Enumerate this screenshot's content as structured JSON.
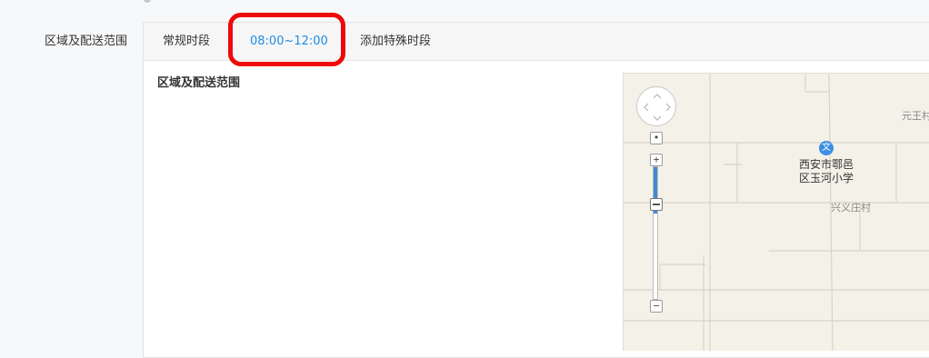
{
  "form": {
    "field_label": "区域及配送范围"
  },
  "tabs": [
    {
      "label": "常规时段",
      "active": false
    },
    {
      "label": "08:00~12:00",
      "active": true
    },
    {
      "label": "添加特殊时段",
      "active": false
    }
  ],
  "section": {
    "title": "区域及配送范围"
  },
  "map": {
    "poi": {
      "icon_text": "文",
      "line1": "西安市鄠邑",
      "line2": "区玉河小学"
    },
    "labels": {
      "village_top_right": "元王村",
      "village_mid": "兴义庄村"
    },
    "zoom": {
      "level_fraction": 0.35
    }
  },
  "colors": {
    "active_tab": "#1a8ce5",
    "highlight": "#ee0a0a",
    "zoom_fill": "#3f8ad6",
    "map_background": "#f4f1e8"
  }
}
